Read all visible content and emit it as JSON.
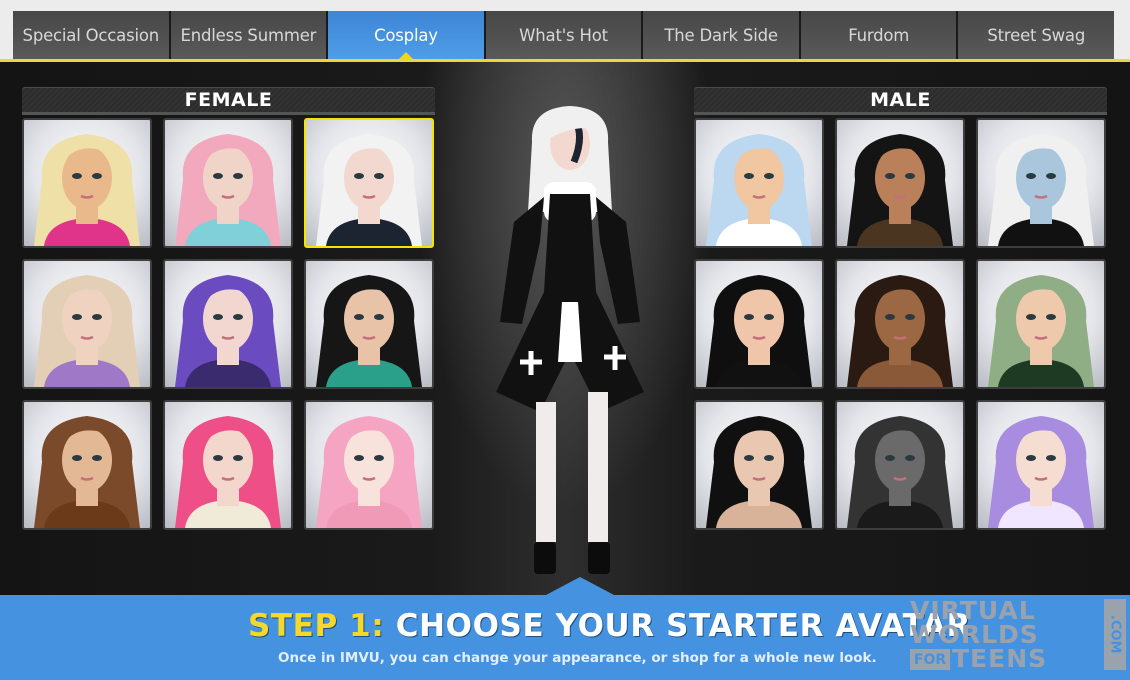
{
  "tabs": [
    {
      "label": "Special Occasion",
      "active": false
    },
    {
      "label": "Endless Summer",
      "active": false
    },
    {
      "label": "Cosplay",
      "active": true
    },
    {
      "label": "What's Hot",
      "active": false
    },
    {
      "label": "The Dark Side",
      "active": false
    },
    {
      "label": "Furdom",
      "active": false
    },
    {
      "label": "Street Swag",
      "active": false
    }
  ],
  "female": {
    "heading": "FEMALE",
    "avatars": [
      {
        "name": "elf-blonde-pink-wings",
        "hair": "#efe0a8",
        "skin": "#e9b98c",
        "accent": "#e0338a",
        "selected": false
      },
      {
        "name": "pastel-rainbow-hair",
        "hair": "#f2a9bd",
        "skin": "#f1d4c8",
        "accent": "#7fd0d8",
        "selected": false
      },
      {
        "name": "white-hair-gothic",
        "hair": "#f2f2f2",
        "skin": "#f3d8cf",
        "accent": "#1b2430",
        "selected": true
      },
      {
        "name": "fairy-lavender-wings",
        "hair": "#e2cfb6",
        "skin": "#f0d2c0",
        "accent": "#a078c8",
        "selected": false
      },
      {
        "name": "purple-hair",
        "hair": "#6b4bc0",
        "skin": "#f1d7d0",
        "accent": "#3a2a6e",
        "selected": false
      },
      {
        "name": "black-hair-green-fur",
        "hair": "#161616",
        "skin": "#e8c3a8",
        "accent": "#2aa08a",
        "selected": false
      },
      {
        "name": "brown-bob-hair",
        "hair": "#7a4a2a",
        "skin": "#e3b894",
        "accent": "#6b3a18",
        "selected": false
      },
      {
        "name": "pink-blonde-hair",
        "hair": "#ee4f86",
        "skin": "#f3d6cc",
        "accent": "#f0ead8",
        "selected": false
      },
      {
        "name": "pastel-pink-hair",
        "hair": "#f5a5c2",
        "skin": "#f7e2dc",
        "accent": "#f09ab8",
        "selected": false
      }
    ]
  },
  "male": {
    "heading": "MALE",
    "avatars": [
      {
        "name": "icy-blue-spiky-hair",
        "hair": "#bcd7f0",
        "skin": "#f0c7a0",
        "accent": "#ffffff",
        "selected": false
      },
      {
        "name": "long-black-hair",
        "hair": "#141414",
        "skin": "#b9805a",
        "accent": "#4a3520",
        "selected": false
      },
      {
        "name": "pale-blue-pinhead",
        "hair": "#f0f0f0",
        "skin": "#a9c6dc",
        "accent": "#111111",
        "selected": false
      },
      {
        "name": "black-emo-hair",
        "hair": "#0f0f0f",
        "skin": "#efc6aa",
        "accent": "#111111",
        "selected": false
      },
      {
        "name": "short-buzz-cut",
        "hair": "#2a1a12",
        "skin": "#9c6843",
        "accent": "#8a5a38",
        "selected": false
      },
      {
        "name": "green-messy-hair",
        "hair": "#8fae86",
        "skin": "#efc9ac",
        "accent": "#1f3a22",
        "selected": false
      },
      {
        "name": "black-pompadour",
        "hair": "#101010",
        "skin": "#eac7b0",
        "accent": "#d8b39a",
        "selected": false
      },
      {
        "name": "grey-spiked-mohawk",
        "hair": "#333333",
        "skin": "#6a6a6a",
        "accent": "#1a1a1a",
        "selected": false
      },
      {
        "name": "lavender-swoop-hair",
        "hair": "#a78ce0",
        "skin": "#f5ddd2",
        "accent": "#f0e6ff",
        "selected": false
      }
    ]
  },
  "preview": {
    "name": "cosplay-gothic-lolita",
    "hair": "#f0f0f0",
    "dress": "#111111",
    "trim": "#ffffff"
  },
  "banner": {
    "step_label": "STEP 1:",
    "title": "CHOOSE YOUR STARTER AVATAR",
    "subtitle": "Once in IMVU, you can change your appearance, or shop for a whole new look."
  },
  "logo": {
    "line1": "VIRTUAL",
    "line2": "WORLDS",
    "for": "FOR",
    "line3": "TEENS",
    "com": ".COM"
  },
  "colors": {
    "accent_blue": "#4593e0",
    "active_tab": "#4a96e4",
    "highlight_yellow": "#f5e400",
    "step_yellow": "#f5d92a"
  }
}
